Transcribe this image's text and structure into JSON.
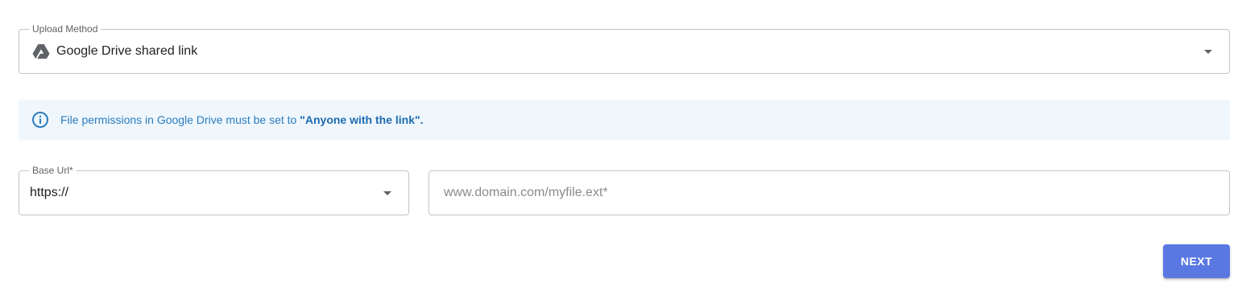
{
  "upload_method": {
    "label": "Upload Method",
    "value": "Google Drive shared link",
    "icon": "google-drive-icon",
    "dropdown_icon": "chevron-down-icon"
  },
  "info_banner": {
    "icon": "info-icon",
    "text_prefix": "File permissions in Google Drive must be set to ",
    "text_quote_open": "\"",
    "text_emphasis": "Anyone with the link",
    "text_quote_close": "\".",
    "text_color": "#2b7bbf",
    "background": "#eff7fc"
  },
  "base_url": {
    "label": "Base Url*",
    "value": "https://",
    "dropdown_icon": "chevron-down-icon"
  },
  "url_input": {
    "placeholder": "www.domain.com/myfile.ext*",
    "value": ""
  },
  "next_button": {
    "label": "NEXT",
    "color": "#5a78e2"
  }
}
